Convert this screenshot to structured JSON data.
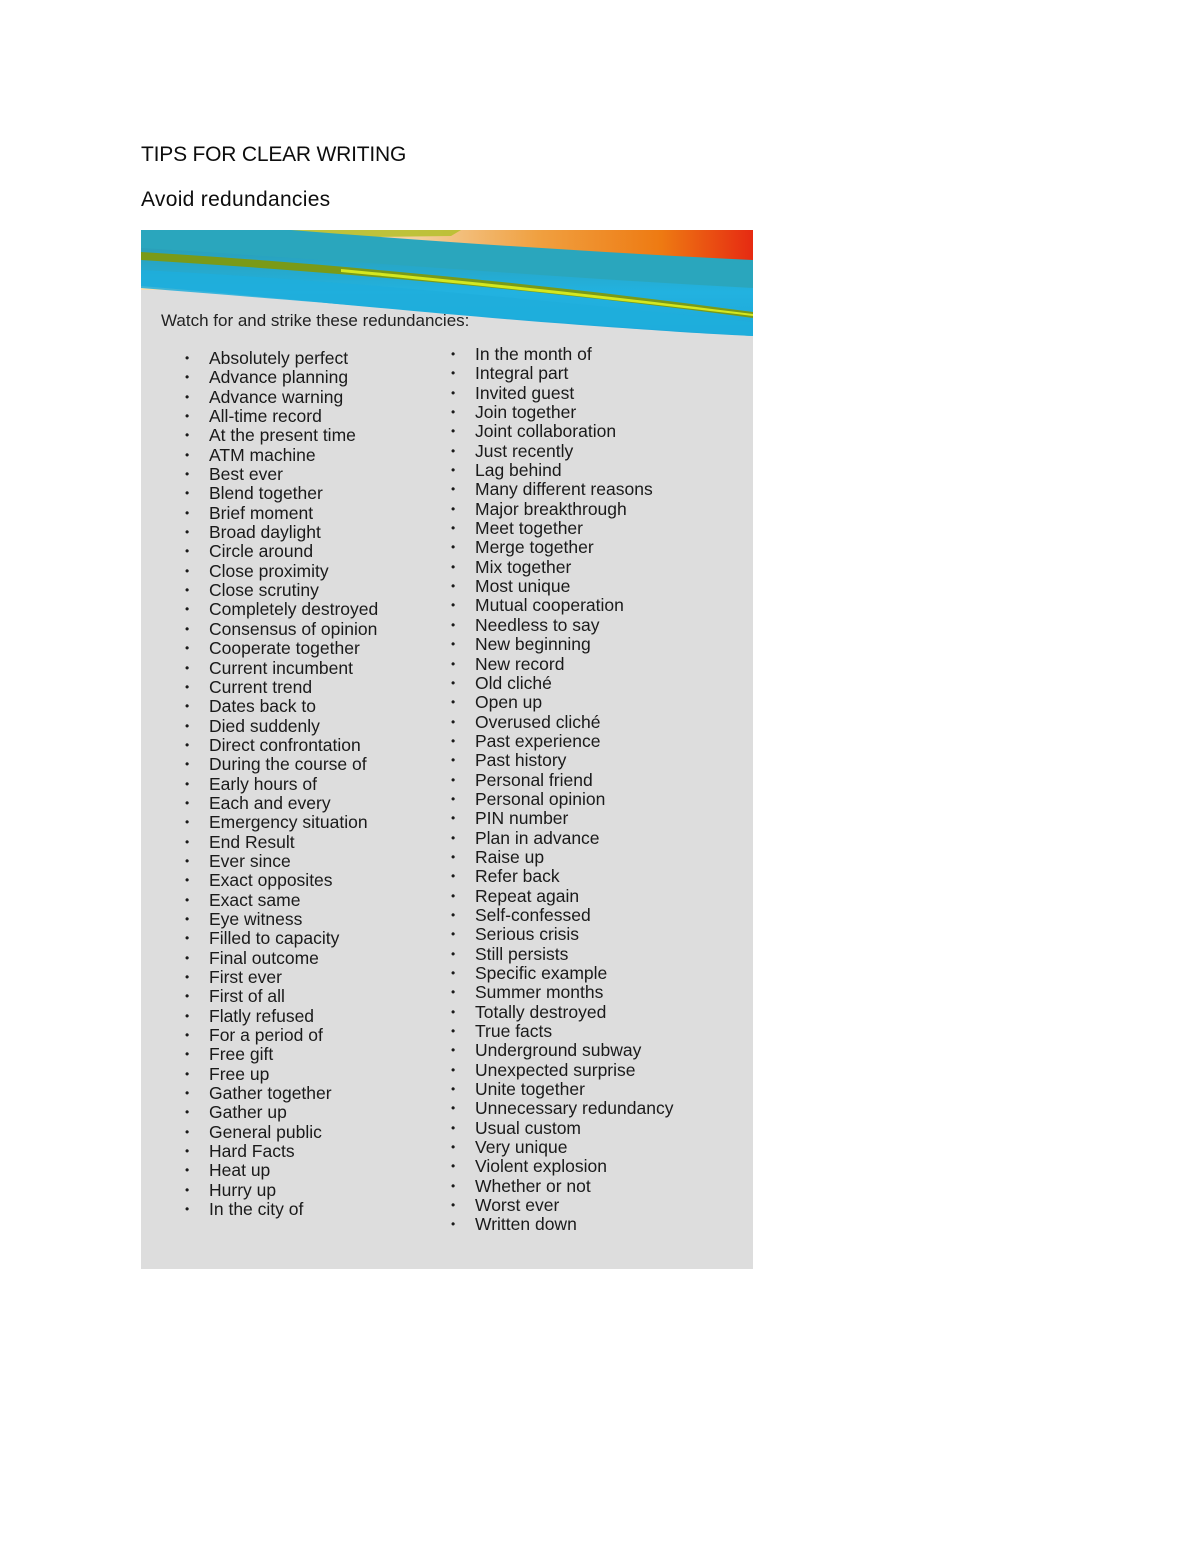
{
  "document": {
    "title": "TIPS FOR CLEAR WRITING",
    "subtitle": "Avoid redundancies"
  },
  "figure": {
    "intro": "Watch for and strike these redundancies:",
    "bullet_glyph": "•",
    "colors": {
      "background": "#dddddd",
      "banner_teal": "#1fa9c9",
      "banner_blue": "#22b2e0",
      "banner_peach": "#f2cfa0",
      "banner_orange": "#ee7a12",
      "banner_red": "#e62a12",
      "banner_green_stripe": "#a8c81a"
    },
    "left_column": [
      "Absolutely perfect",
      "Advance planning",
      "Advance warning",
      "All-time record",
      "At the present time",
      "ATM machine",
      "Best ever",
      "Blend together",
      "Brief moment",
      "Broad daylight",
      "Circle around",
      "Close proximity",
      "Close scrutiny",
      "Completely destroyed",
      "Consensus of opinion",
      "Cooperate together",
      "Current incumbent",
      "Current trend",
      "Dates back to",
      "Died suddenly",
      "Direct confrontation",
      "During the course of",
      "Early hours of",
      "Each and every",
      "Emergency situation",
      "End Result",
      "Ever since",
      "Exact opposites",
      "Exact same",
      "Eye witness",
      "Filled to capacity",
      "Final outcome",
      "First ever",
      "First of all",
      "Flatly refused",
      "For a period of",
      "Free gift",
      "Free up",
      "Gather together",
      "Gather up",
      "General public",
      "Hard Facts",
      "Heat up",
      "Hurry up",
      "In the city of"
    ],
    "right_column": [
      "In the month of",
      "Integral part",
      "Invited guest",
      "Join together",
      "Joint collaboration",
      "Just recently",
      "Lag behind",
      "Many different reasons",
      "Major breakthrough",
      "Meet together",
      "Merge together",
      "Mix together",
      "Most unique",
      "Mutual cooperation",
      "Needless to say",
      "New beginning",
      "New record",
      "Old cliché",
      "Open up",
      "Overused cliché",
      "Past experience",
      "Past history",
      "Personal friend",
      "Personal opinion",
      "PIN number",
      "Plan in advance",
      "Raise up",
      "Refer back",
      "Repeat again",
      "Self-confessed",
      "Serious crisis",
      "Still persists",
      "Specific example",
      "Summer months",
      "Totally destroyed",
      "True facts",
      "Underground subway",
      "Unexpected surprise",
      "Unite together",
      "Unnecessary redundancy",
      "Usual custom",
      "Very unique",
      "Violent explosion",
      "Whether or not",
      "Worst ever",
      "Written down"
    ]
  }
}
